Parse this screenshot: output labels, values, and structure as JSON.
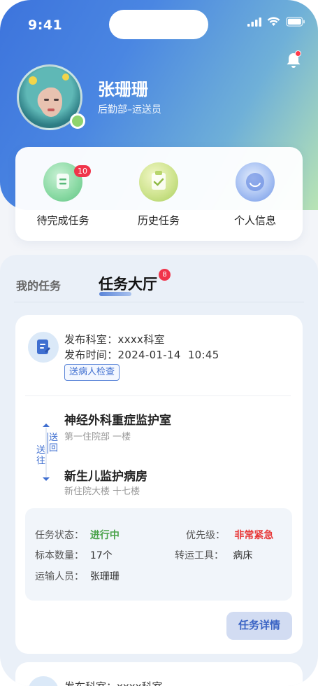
{
  "status_bar": {
    "time": "9:41"
  },
  "user": {
    "name": "张珊珊",
    "dept": "后勤部–运送员"
  },
  "quick_actions": [
    {
      "label": "待完成任务",
      "badge": "10",
      "icon": "task-list-icon"
    },
    {
      "label": "历史任务",
      "icon": "clipboard-check-icon"
    },
    {
      "label": "个人信息",
      "icon": "profile-icon"
    }
  ],
  "tabs": {
    "my_tasks": "我的任务",
    "task_hall": "任务大厅",
    "task_hall_badge": "8"
  },
  "task": {
    "dept_key": "发布科室：",
    "dept_val": "xxxx科室",
    "time_key": "发布时间：",
    "time_val": "2024-01-14  10:45",
    "tag": "送病人检查",
    "route_labels": {
      "return": "送回",
      "to": "送往"
    },
    "from": {
      "title": "神经外科重症监护室",
      "sub": "第一住院部 一楼"
    },
    "to": {
      "title": "新生儿监护病房",
      "sub": "新住院大楼 十七楼"
    },
    "status_key": "任务状态：",
    "status_val": "进行中",
    "priority_key": "优先级：",
    "priority_val": "非常紧急",
    "sample_key": "标本数量：",
    "sample_val": "17个",
    "tool_key": "转运工具：",
    "tool_val": "病床",
    "staff_key": "运输人员：",
    "staff_val": "张珊珊",
    "detail_button": "任务详情"
  },
  "next_task": {
    "dept_key": "发布科室：",
    "dept_val": "xxxx科室"
  },
  "colors": {
    "accent": "#3a63c4",
    "status_green": "#4aa34a",
    "priority_red": "#e83a3a",
    "badge_red": "#f0344a"
  }
}
